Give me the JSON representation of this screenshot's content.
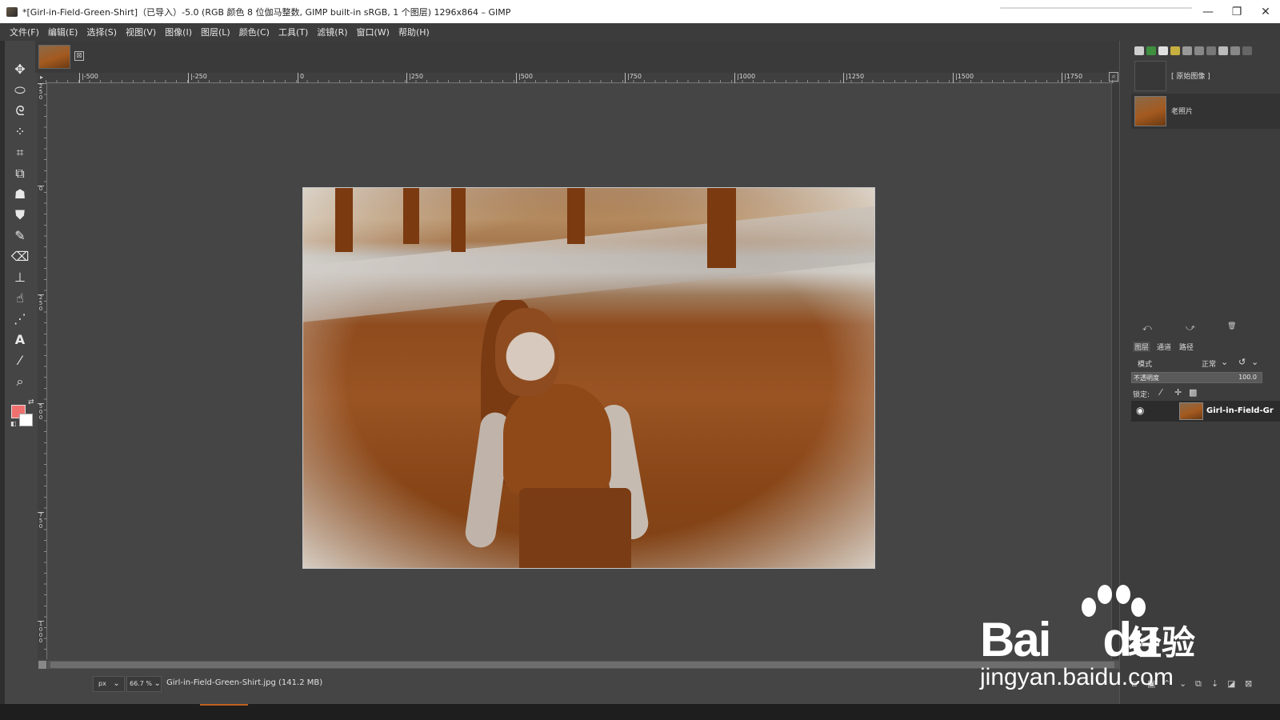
{
  "window": {
    "title": "*[Girl-in-Field-Green-Shirt]（已导入）-5.0 (RGB 颜色 8 位伽马整数, GIMP built-in sRGB, 1 个图层) 1296x864 – GIMP",
    "minimize": "—",
    "maximize": "❐",
    "close": "✕"
  },
  "menu": [
    "文件(F)",
    "编辑(E)",
    "选择(S)",
    "视图(V)",
    "图像(I)",
    "图层(L)",
    "颜色(C)",
    "工具(T)",
    "滤镜(R)",
    "窗口(W)",
    "帮助(H)"
  ],
  "image_tab": {
    "close": "⊠"
  },
  "ruler": {
    "h_ticks": [
      "|-500",
      "|-250",
      "0",
      "|250",
      "|500",
      "|750",
      "|1000",
      "|1250",
      "|1500",
      "|1750"
    ],
    "v_ticks": [
      "2 5 0",
      "0",
      "2 5 0",
      "5 0 0",
      "7 5 0",
      "1 0 0 0"
    ]
  },
  "colors": {
    "foreground": "#f07070",
    "background": "#ffffff",
    "accent": "#c06020"
  },
  "history": {
    "items": [
      {
        "label": "[ 原始图像 ]",
        "thumb": "blank"
      },
      {
        "label": "老照片",
        "thumb": "photo"
      }
    ]
  },
  "undo_icons": [
    "⤺",
    "⤻",
    "🗑"
  ],
  "layers_panel": {
    "tabs": [
      "图层",
      "通道",
      "路径"
    ],
    "mode_label": "模式",
    "mode_value": "正常",
    "opacity_label": "不透明度",
    "opacity_value": "100.0",
    "lock_label": "锁定:",
    "layer_name": "Girl-in-Field-Gr"
  },
  "status": {
    "unit": "px",
    "zoom": "66.7 %",
    "file_info": "Girl-in-Field-Green-Shirt.jpg (141.2 MB)"
  },
  "watermark": {
    "brand_left": "Bai",
    "brand_right": "du",
    "chinese": "经验",
    "url": "jingyan.baidu.com"
  }
}
